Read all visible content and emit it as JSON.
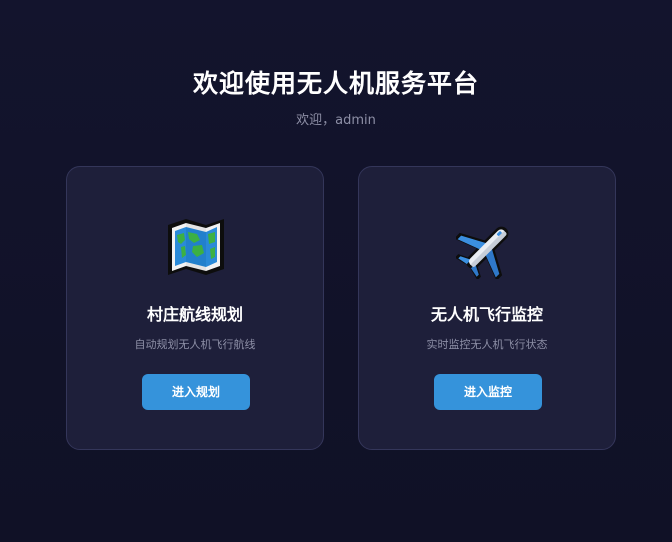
{
  "header": {
    "title": "欢迎使用无人机服务平台",
    "welcome": "欢迎，admin"
  },
  "cards": [
    {
      "icon": "world-map-icon",
      "title": "村庄航线规划",
      "description": "自动规划无人机飞行航线",
      "button_label": "进入规划"
    },
    {
      "icon": "airplane-icon",
      "title": "无人机飞行监控",
      "description": "实时监控无人机飞行状态",
      "button_label": "进入监控"
    }
  ],
  "colors": {
    "background": "#12132b",
    "card_background": "#1e1f3a",
    "card_border": "#34365a",
    "button": "#3593db",
    "muted_text": "#8d8fa6"
  }
}
